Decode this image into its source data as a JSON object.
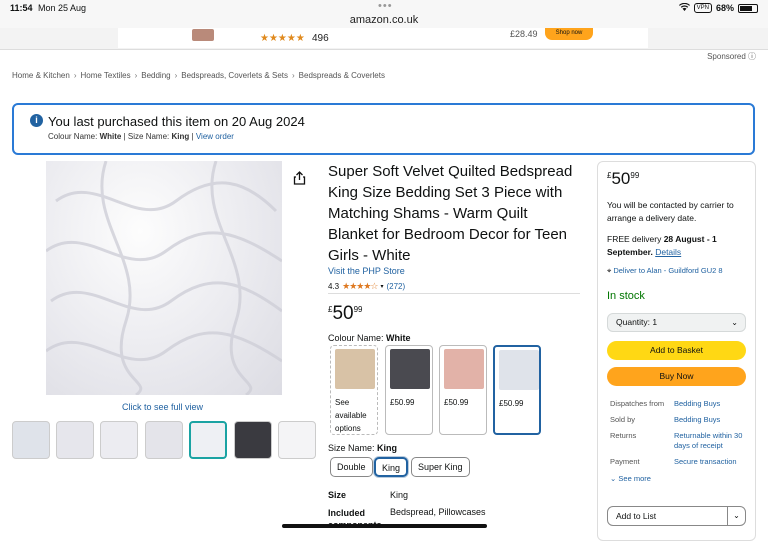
{
  "status_bar": {
    "time": "11:54",
    "date": "Mon 25 Aug",
    "url": "amazon.co.uk",
    "vpn": "VPN",
    "battery": "68%",
    "dots": "•••"
  },
  "ad": {
    "review_count": "496",
    "price": "£28.49",
    "button": "Shop now",
    "stars": "★★★★★"
  },
  "sponsored": "Sponsored ⓘ",
  "breadcrumbs": [
    "Home & Kitchen",
    "Home Textiles",
    "Bedding",
    "Bedspreads, Coverlets & Sets",
    "Bedspreads & Coverlets"
  ],
  "banner": {
    "message": "You last purchased this item on 20 Aug 2024",
    "colour_label": "Colour Name:",
    "colour_value": "White",
    "separator": "|",
    "size_label": "Size Name:",
    "size_value": "King",
    "link": "View order"
  },
  "gallery": {
    "full_view": "Click to see full view",
    "thumb_count": 7
  },
  "product": {
    "title": "Super Soft Velvet Quilted Bedspread King Size Bedding Set 3 Piece with Matching Shams - Warm Quilt Blanket for Bedroom Decor for Teen Girls - White",
    "store": "Visit the PHP Store",
    "rating": "4.3",
    "stars": "★★★★☆",
    "rating_count": "(272)",
    "price_currency": "£",
    "price_whole": "50",
    "price_fraction": "99",
    "colour_label": "Colour Name:",
    "colour_value": "White",
    "swatches": [
      {
        "text": "See available options",
        "color": "#d8c2a6"
      },
      {
        "text": "£50.99",
        "color": "#4a4a50"
      },
      {
        "text": "£50.99",
        "color": "#e2b2a8"
      },
      {
        "text": "£50.99",
        "color": "#eef0f4"
      }
    ],
    "size_label": "Size Name:",
    "size_value": "King",
    "sizes": [
      "Double",
      "King",
      "Super King"
    ],
    "specs": [
      {
        "k": "Size",
        "v": "King"
      },
      {
        "k": "Included components",
        "v": "Bedspread, Pillowcases"
      }
    ]
  },
  "buybox": {
    "price_currency": "£",
    "price_whole": "50",
    "price_fraction": "99",
    "contact": "You will be contacted by carrier to arrange a delivery date.",
    "delivery_prefix": "FREE delivery",
    "delivery_dates": "28 August - 1 September.",
    "details": "Details",
    "location": "Deliver to Alan - Guildford GU2 8",
    "stock": "In stock",
    "quantity": "Quantity:  1",
    "add_to_basket": "Add to Basket",
    "buy_now": "Buy Now",
    "info": [
      {
        "k": "Dispatches from",
        "v": "Bedding Buys"
      },
      {
        "k": "Sold by",
        "v": "Bedding Buys"
      },
      {
        "k": "Returns",
        "v": "Returnable within 30 days of receipt"
      },
      {
        "k": "Payment",
        "v": "Secure transaction"
      }
    ],
    "see_more": "See more",
    "add_to_list": "Add to List"
  },
  "colors": {
    "link": "#2162a1",
    "accent_yellow": "#ffd814",
    "accent_orange": "#ffa41c",
    "stock_green": "#007600"
  }
}
